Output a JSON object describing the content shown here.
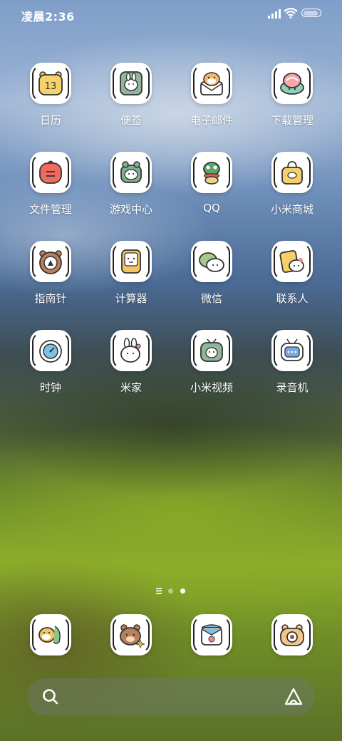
{
  "status_bar": {
    "time": "凌晨2:36",
    "battery_level": 0.9
  },
  "apps": [
    {
      "label": "日历",
      "icon": "calendar-bear-icon"
    },
    {
      "label": "便签",
      "icon": "notes-bunny-icon"
    },
    {
      "label": "电子邮件",
      "icon": "email-hamster-icon"
    },
    {
      "label": "下载管理",
      "icon": "download-turtle-icon"
    },
    {
      "label": "文件管理",
      "icon": "file-folder-icon"
    },
    {
      "label": "游戏中心",
      "icon": "game-frog-icon"
    },
    {
      "label": "QQ",
      "icon": "qq-frog-icon"
    },
    {
      "label": "小米商城",
      "icon": "shopping-bag-icon"
    },
    {
      "label": "指南针",
      "icon": "compass-bear-icon"
    },
    {
      "label": "计算器",
      "icon": "calculator-icon"
    },
    {
      "label": "微信",
      "icon": "wechat-bubble-icon"
    },
    {
      "label": "联系人",
      "icon": "contacts-cat-icon"
    },
    {
      "label": "时钟",
      "icon": "clock-icon"
    },
    {
      "label": "米家",
      "icon": "mijia-bunny-icon"
    },
    {
      "label": "小米视频",
      "icon": "video-tv-icon"
    },
    {
      "label": "录音机",
      "icon": "recorder-radio-icon"
    }
  ],
  "dock": [
    {
      "icon": "phone-hamster-icon"
    },
    {
      "icon": "messages-bear-icon"
    },
    {
      "icon": "browser-envelope-icon"
    },
    {
      "icon": "camera-bear-icon"
    }
  ],
  "page_indicator": {
    "count": 2,
    "active": 1
  },
  "search_bar": {
    "left_icon": "search-icon",
    "right_icon": "assistant-icon"
  },
  "colors": {
    "label_text": "#ffffff",
    "tile_bg": "#ffffff",
    "outline": "#222222"
  }
}
